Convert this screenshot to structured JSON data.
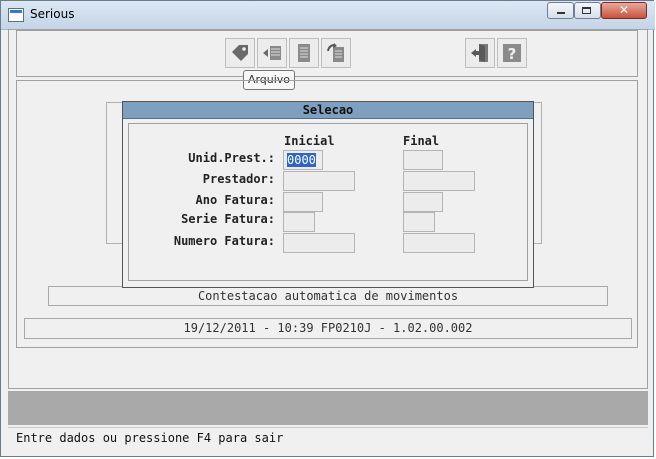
{
  "window": {
    "title": "Serious"
  },
  "toolbar": {
    "buttons": [
      {
        "icon": "tag-icon"
      },
      {
        "icon": "list-arrow-icon"
      },
      {
        "icon": "document-icon"
      },
      {
        "icon": "refresh-document-icon"
      },
      {
        "icon": "exit-door-icon"
      },
      {
        "icon": "help-icon"
      }
    ],
    "tooltip": "Arquivo"
  },
  "dialog": {
    "title": "Selecao",
    "col_initial": "Inicial",
    "col_final": "Final",
    "rows": [
      {
        "label": "Unid.Prest.:",
        "initial": "0000",
        "final": ""
      },
      {
        "label": "Prestador:",
        "initial": "",
        "final": ""
      },
      {
        "label": "Ano Fatura:",
        "initial": "",
        "final": ""
      },
      {
        "label": "Serie Fatura:",
        "initial": "",
        "final": ""
      },
      {
        "label": "Numero Fatura:",
        "initial": "",
        "final": ""
      }
    ]
  },
  "program_bar": "Contestacao automatica de movimentos",
  "info_bar": "19/12/2011 - 10:39  FP0210J - 1.02.00.002",
  "status": "Entre dados ou pressione F4 para sair",
  "colors": {
    "titlebar": "#c9d9ec",
    "dialog_title": "#7f9fbf",
    "selection": "#3165c5",
    "band": "#a9a9a9"
  }
}
